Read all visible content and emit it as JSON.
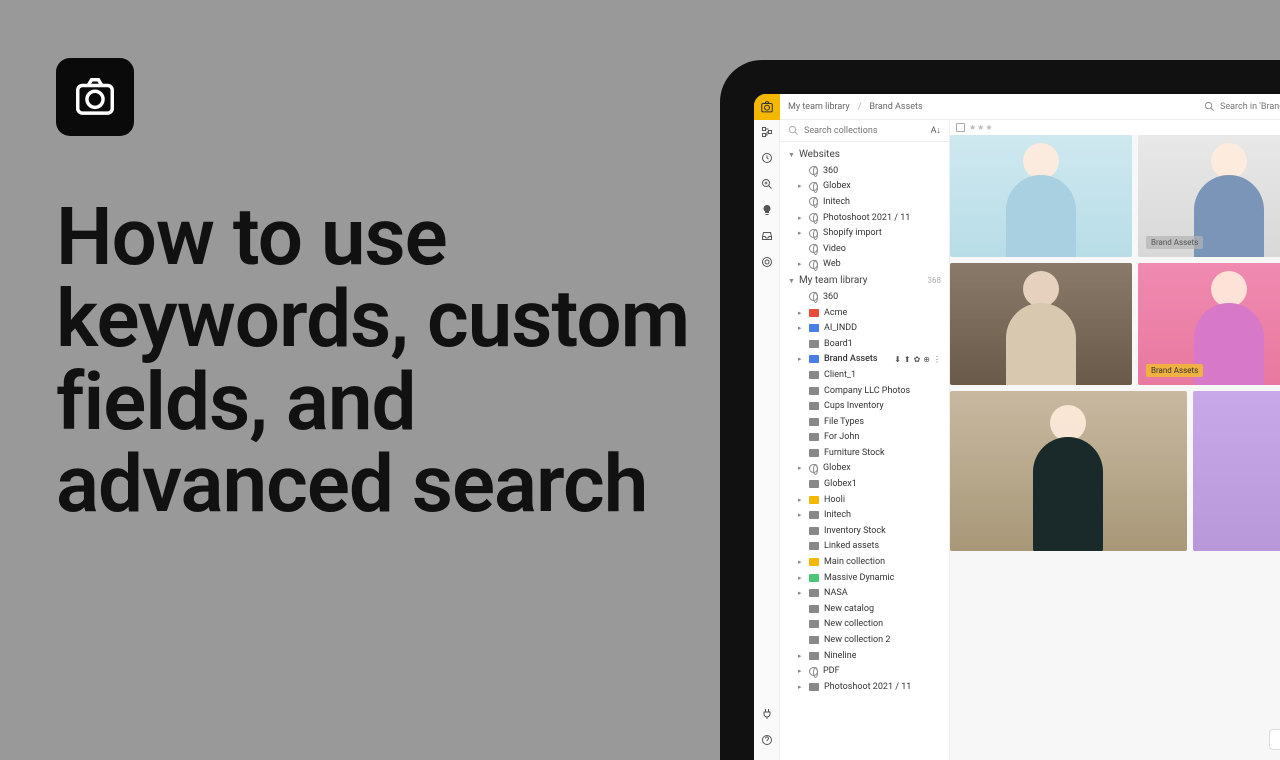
{
  "headline": "How to use keywords, custom fields, and advanced search",
  "breadcrumb": {
    "root": "My team library",
    "current": "Brand Assets"
  },
  "search": {
    "top_placeholder": "Search in 'Brand Assets'",
    "side_placeholder": "Search collections"
  },
  "sections": [
    {
      "name": "Websites",
      "count": "",
      "items": [
        {
          "label": "360",
          "icon": "globe",
          "expand": "none"
        },
        {
          "label": "Globex",
          "icon": "globe",
          "expand": "caret"
        },
        {
          "label": "Initech",
          "icon": "globe",
          "expand": "none"
        },
        {
          "label": "Photoshoot 2021 / 11",
          "icon": "globe",
          "expand": "caret"
        },
        {
          "label": "Shopify import",
          "icon": "globe",
          "expand": "caret"
        },
        {
          "label": "Video",
          "icon": "globe",
          "expand": "none"
        },
        {
          "label": "Web",
          "icon": "globe",
          "expand": "caret"
        }
      ]
    },
    {
      "name": "My team library",
      "count": "368",
      "items": [
        {
          "label": "360",
          "icon": "globe",
          "expand": "none"
        },
        {
          "label": "Acme",
          "icon": "folder",
          "color": "#e74c3c",
          "expand": "caret"
        },
        {
          "label": "AI_INDD",
          "icon": "folder",
          "color": "#4a7de8",
          "expand": "caret"
        },
        {
          "label": "Board1",
          "icon": "folder",
          "color": "#888",
          "expand": "none"
        },
        {
          "label": "Brand Assets",
          "icon": "folder",
          "color": "#4a7de8",
          "expand": "caret",
          "selected": true,
          "actions": true
        },
        {
          "label": "Client_1",
          "icon": "folder",
          "color": "#888",
          "expand": "none"
        },
        {
          "label": "Company LLC Photos",
          "icon": "folder",
          "color": "#888",
          "expand": "none"
        },
        {
          "label": "Cups Inventory",
          "icon": "folder",
          "color": "#888",
          "expand": "none"
        },
        {
          "label": "File Types",
          "icon": "folder",
          "color": "#888",
          "expand": "none"
        },
        {
          "label": "For John",
          "icon": "folder",
          "color": "#888",
          "expand": "none"
        },
        {
          "label": "Furniture Stock",
          "icon": "folder",
          "color": "#888",
          "expand": "none"
        },
        {
          "label": "Globex",
          "icon": "globe",
          "expand": "caret"
        },
        {
          "label": "Globex1",
          "icon": "folder",
          "color": "#888",
          "expand": "none"
        },
        {
          "label": "Hooli",
          "icon": "folder",
          "color": "#f5b800",
          "expand": "caret"
        },
        {
          "label": "Initech",
          "icon": "folder",
          "color": "#888",
          "expand": "caret"
        },
        {
          "label": "Inventory Stock",
          "icon": "folder",
          "color": "#888",
          "expand": "none"
        },
        {
          "label": "Linked assets",
          "icon": "folder",
          "color": "#888",
          "expand": "none"
        },
        {
          "label": "Main collection",
          "icon": "folder",
          "color": "#f5b800",
          "expand": "caret"
        },
        {
          "label": "Massive Dynamic",
          "icon": "folder",
          "color": "#4ac878",
          "expand": "caret"
        },
        {
          "label": "NASA",
          "icon": "folder",
          "color": "#888",
          "expand": "caret"
        },
        {
          "label": "New catalog",
          "icon": "folder",
          "color": "#888",
          "expand": "none"
        },
        {
          "label": "New collection",
          "icon": "folder",
          "color": "#888",
          "expand": "none"
        },
        {
          "label": "New collection 2",
          "icon": "folder",
          "color": "#888",
          "expand": "none"
        },
        {
          "label": "Nineline",
          "icon": "folder",
          "color": "#888",
          "expand": "caret"
        },
        {
          "label": "PDF",
          "icon": "globe",
          "expand": "caret"
        },
        {
          "label": "Photoshoot 2021 / 11",
          "icon": "folder",
          "color": "#888",
          "expand": "caret"
        }
      ]
    }
  ],
  "tags": {
    "badge": "Brand Assets"
  },
  "folder_colors": {
    "default": "#888"
  }
}
